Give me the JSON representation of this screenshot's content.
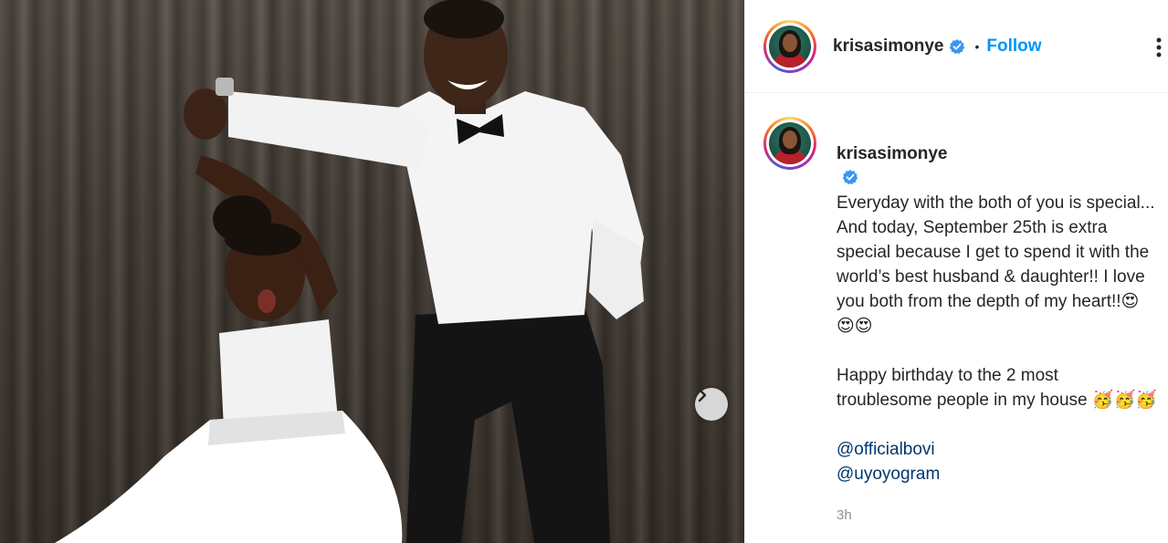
{
  "post": {
    "username": "krisasimonye",
    "follow_label": "Follow",
    "separator": "•",
    "caption_lines": [
      "Everyday with the both of you is special...",
      "And today, September 25th is extra special because I get to spend it with the world’s best husband & daughter!! I love you both from the depth of my heart!!😍😍😍"
    ],
    "caption_line_2": "Happy birthday to the 2 most troublesome people in my house 🥳🥳🥳",
    "mentions": [
      "@officialbovi",
      "@uyoyogram"
    ],
    "timestamp": "3h"
  },
  "icons": {
    "verified": "verified-badge-icon",
    "more": "more-options-icon",
    "next": "chevron-right-icon"
  },
  "colors": {
    "accent": "#0095f6",
    "verified": "#3897f0",
    "mention": "#00376b",
    "muted": "#8e8e8e"
  }
}
